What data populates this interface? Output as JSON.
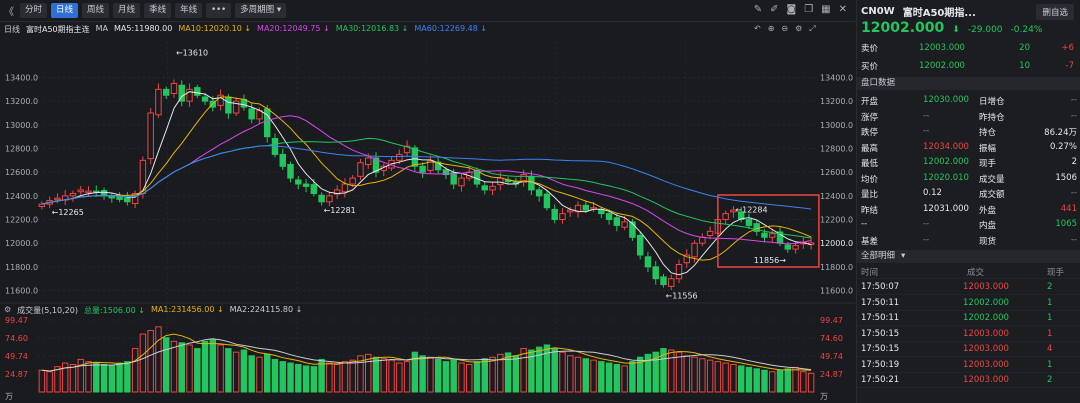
{
  "toolbar": {
    "collapse_icon": "《",
    "periods": [
      "分时",
      "日线",
      "周线",
      "月线",
      "季线",
      "年线"
    ],
    "more": "•••",
    "multi_period": "多周期图"
  },
  "ma": {
    "label": "日线",
    "title": "富时A50期指主连",
    "prefix": "MA",
    "ma5": "MA5:11980.00",
    "ma10": "MA10:12020.10 ↓",
    "ma20": "MA20:12049.75 ↓",
    "ma30": "MA30:12016.83 ↓",
    "ma60": "MA60:12269.48 ↓"
  },
  "vol": {
    "label": "成交量(5,10,20)",
    "total": "总量:1506.00 ↓",
    "ma1": "MA1:231456.00 ↓",
    "ma2": "MA2:224115.80 ↓"
  },
  "quote": {
    "code": "CN0W",
    "name": "富时A50期指...",
    "button": "删自选",
    "price": "12002.000",
    "change": "-29.000",
    "change_pct": "-0.24%",
    "section_title": "盘口数据"
  },
  "orderbook": [
    {
      "label": "卖价",
      "price": "12003.000",
      "vol": "20",
      "delta": "+6"
    },
    {
      "label": "买价",
      "price": "12002.000",
      "vol": "10",
      "delta": "-7"
    }
  ],
  "stats": [
    {
      "l1": "开盘",
      "v1": "12030.000",
      "c1": "green",
      "l2": "日增仓",
      "v2": "--",
      "c2": "muted"
    },
    {
      "l1": "涨停",
      "v1": "--",
      "c1": "muted",
      "l2": "昨持仓",
      "v2": "--",
      "c2": "muted"
    },
    {
      "l1": "跌停",
      "v1": "--",
      "c1": "muted",
      "l2": "持仓",
      "v2": "86.24万",
      "c2": "white"
    },
    {
      "l1": "最高",
      "v1": "12034.000",
      "c1": "red",
      "l2": "振幅",
      "v2": "0.27%",
      "c2": "white"
    },
    {
      "l1": "最低",
      "v1": "12002.000",
      "c1": "green",
      "l2": "现手",
      "v2": "2",
      "c2": "white"
    },
    {
      "l1": "均价",
      "v1": "12020.010",
      "c1": "green",
      "l2": "成交量",
      "v2": "1506",
      "c2": "white"
    },
    {
      "l1": "量比",
      "v1": "0.12",
      "c1": "white",
      "l2": "成交额",
      "v2": "--",
      "c2": "muted"
    },
    {
      "l1": "昨结",
      "v1": "12031.000",
      "c1": "white",
      "l2": "外盘",
      "v2": "441",
      "c2": "red"
    },
    {
      "l1": "--",
      "v1": "--",
      "c1": "muted",
      "l2": "内盘",
      "v2": "1065",
      "c2": "green"
    },
    {
      "l1": "基差",
      "v1": "--",
      "c1": "muted",
      "l2": "现货",
      "v2": "--",
      "c2": "muted"
    }
  ],
  "trades": {
    "title": "全部明细",
    "headers": [
      "时间",
      "成交",
      "现手"
    ],
    "rows": [
      {
        "time": "17:50:07",
        "price": "12003.000",
        "vol": "2",
        "pc": "red",
        "vc": "green"
      },
      {
        "time": "17:50:11",
        "price": "12002.000",
        "vol": "1",
        "pc": "green",
        "vc": "green"
      },
      {
        "time": "17:50:11",
        "price": "12002.000",
        "vol": "1",
        "pc": "green",
        "vc": "green"
      },
      {
        "time": "17:50:15",
        "price": "12003.000",
        "vol": "1",
        "pc": "red",
        "vc": "red"
      },
      {
        "time": "17:50:15",
        "price": "12003.000",
        "vol": "4",
        "pc": "red",
        "vc": "red"
      },
      {
        "time": "17:50:19",
        "price": "12003.000",
        "vol": "1",
        "pc": "red",
        "vc": "green"
      },
      {
        "time": "17:50:21",
        "price": "12003.000",
        "vol": "2",
        "pc": "red",
        "vc": "green"
      }
    ]
  },
  "chart_data": {
    "type": "candlestick",
    "price_axis_ticks": [
      "13400.0",
      "13200.0",
      "13000.0",
      "12800.0",
      "12600.0",
      "12400.0",
      "12200.0",
      "12000.0",
      "11800.0",
      "11600.0"
    ],
    "ylim": [
      11520,
      13700
    ],
    "current_price_label": "12000.0",
    "annotations": [
      {
        "text": "←13610",
        "value": 13610,
        "index": 17
      },
      {
        "text": "←12265",
        "value": 12265,
        "index": 1
      },
      {
        "text": "←12281",
        "value": 12281,
        "index": 36
      },
      {
        "text": "←11556",
        "value": 11556,
        "index": 80
      },
      {
        "text": "←12284",
        "value": 12284,
        "index": 89
      },
      {
        "text": "11856→",
        "value": 11856,
        "index": 96
      }
    ],
    "volume_axis_ticks": [
      "99.47",
      "74.60",
      "49.74",
      "24.87"
    ],
    "volume_unit": "万",
    "volume_max": 99.47,
    "closes": [
      12330,
      12360,
      12380,
      12400,
      12420,
      12450,
      12440,
      12430,
      12410,
      12390,
      12370,
      12350,
      12420,
      12700,
      13100,
      13300,
      13250,
      13350,
      13200,
      13300,
      13250,
      13200,
      13150,
      13250,
      13100,
      13200,
      13150,
      13050,
      13120,
      12900,
      12750,
      12650,
      12550,
      12500,
      12480,
      12420,
      12350,
      12400,
      12450,
      12500,
      12550,
      12680,
      12720,
      12600,
      12650,
      12700,
      12750,
      12820,
      12650,
      12600,
      12700,
      12620,
      12580,
      12500,
      12550,
      12600,
      12500,
      12450,
      12480,
      12550,
      12520,
      12500,
      12580,
      12450,
      12400,
      12300,
      12200,
      12250,
      12280,
      12320,
      12280,
      12300,
      12250,
      12200,
      12150,
      12180,
      12050,
      11900,
      11800,
      11700,
      11650,
      11700,
      11820,
      11900,
      12000,
      12050,
      12100,
      12200,
      12250,
      12280,
      12200,
      12150,
      12100,
      12050,
      12080,
      12000,
      11950,
      11980,
      12010,
      12002
    ],
    "volumes": [
      30,
      28,
      35,
      40,
      38,
      45,
      42,
      40,
      38,
      36,
      40,
      42,
      60,
      80,
      85,
      90,
      75,
      70,
      68,
      65,
      60,
      70,
      72,
      65,
      60,
      55,
      58,
      50,
      48,
      52,
      45,
      42,
      40,
      38,
      36,
      35,
      45,
      40,
      38,
      42,
      44,
      50,
      52,
      48,
      46,
      44,
      40,
      42,
      55,
      50,
      48,
      45,
      42,
      44,
      40,
      38,
      42,
      46,
      48,
      52,
      54,
      50,
      60,
      58,
      62,
      65,
      60,
      55,
      50,
      48,
      46,
      44,
      42,
      40,
      38,
      36,
      42,
      48,
      52,
      55,
      60,
      58,
      55,
      50,
      48,
      46,
      44,
      42,
      40,
      38,
      36,
      34,
      32,
      30,
      28,
      30,
      32,
      34,
      28,
      26
    ],
    "series": [
      {
        "name": "MA5",
        "color": "#e5e7eb"
      },
      {
        "name": "MA10",
        "color": "#eab308"
      },
      {
        "name": "MA20",
        "color": "#d946ef"
      },
      {
        "name": "MA30",
        "color": "#22c55e"
      },
      {
        "name": "MA60",
        "color": "#3b82f6"
      }
    ],
    "volume_series": [
      {
        "name": "MA1",
        "color": "#eab308"
      },
      {
        "name": "MA2",
        "color": "#c9ccd3"
      }
    ],
    "highlight_range": [
      88,
      99
    ]
  }
}
